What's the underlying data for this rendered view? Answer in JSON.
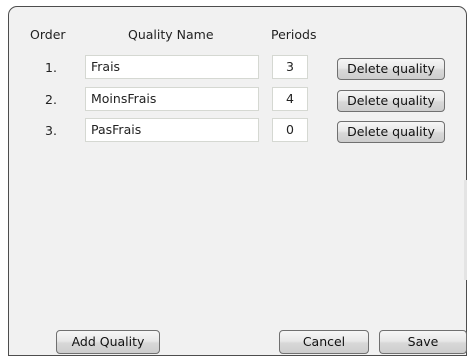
{
  "table": {
    "headers": {
      "order": "Order",
      "quality_name": "Quality Name",
      "periods": "Periods"
    },
    "rows": [
      {
        "order": "1.",
        "name": "Frais",
        "periods": "3",
        "delete_label": "Delete quality"
      },
      {
        "order": "2.",
        "name": "MoinsFrais",
        "periods": "4",
        "delete_label": "Delete quality"
      },
      {
        "order": "3.",
        "name": "PasFrais",
        "periods": "0",
        "delete_label": "Delete quality"
      }
    ]
  },
  "footer": {
    "add_label": "Add Quality",
    "cancel_label": "Cancel",
    "save_label": "Save"
  }
}
